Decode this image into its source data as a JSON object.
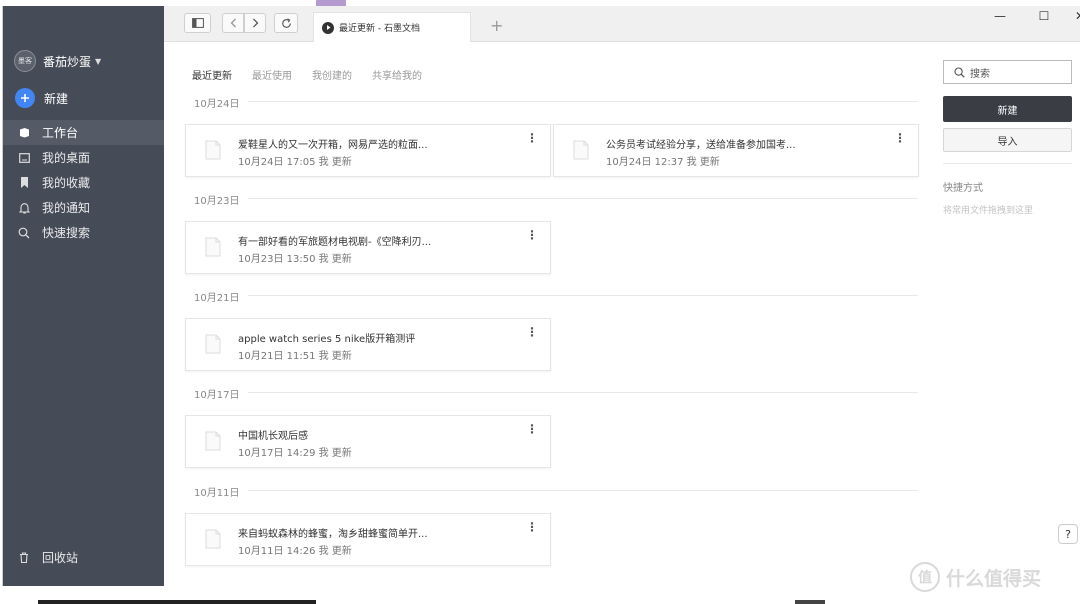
{
  "sidebar": {
    "user": "番茄炒蛋",
    "avatar_text": "墨客",
    "new_label": "新建",
    "items": [
      {
        "label": "工作台",
        "icon": "workbench-icon",
        "active": true
      },
      {
        "label": "我的桌面",
        "icon": "desktop-icon",
        "active": false
      },
      {
        "label": "我的收藏",
        "icon": "bookmark-icon",
        "active": false
      },
      {
        "label": "我的通知",
        "icon": "bell-icon",
        "active": false
      },
      {
        "label": "快速搜索",
        "icon": "search-icon",
        "active": false
      }
    ],
    "trash_label": "回收站"
  },
  "topbar": {
    "tab_title": "最近更新 - 石墨文档",
    "add_tab": "+",
    "window_controls": [
      "—",
      "☐",
      "✕"
    ]
  },
  "subtabs": [
    "最近更新",
    "最近使用",
    "我创建的",
    "共享给我的"
  ],
  "groups": [
    {
      "date": "10月24日",
      "files": [
        {
          "title": "爱鞋星人的又一次开箱，网易严选的粒面...",
          "meta": "10月24日 17:05 我 更新"
        },
        {
          "title": "公务员考试经验分享，送给准备参加国考...",
          "meta": "10月24日 12:37 我 更新"
        }
      ]
    },
    {
      "date": "10月23日",
      "files": [
        {
          "title": "有一部好看的军旅题材电视剧-《空降利刃...",
          "meta": "10月23日 13:50 我 更新"
        }
      ]
    },
    {
      "date": "10月21日",
      "files": [
        {
          "title": "apple watch series 5 nike版开箱测评",
          "meta": "10月21日 11:51 我 更新"
        }
      ]
    },
    {
      "date": "10月17日",
      "files": [
        {
          "title": "中国机长观后感",
          "meta": "10月17日 14:29 我 更新"
        }
      ]
    },
    {
      "date": "10月11日",
      "files": [
        {
          "title": "来自蚂蚁森林的蜂蜜，淘乡甜蜂蜜简单开...",
          "meta": "10月11日 14:26 我 更新"
        }
      ]
    }
  ],
  "right_panel": {
    "search_placeholder": "搜索",
    "new_button": "新建",
    "import_button": "导入",
    "shortcut_title": "快捷方式",
    "shortcut_hint": "将常用文件拖拽到这里"
  },
  "help_label": "?",
  "watermark": {
    "logo": "值",
    "text": "什么值得买"
  },
  "colors": {
    "sidebar_bg": "#464c57",
    "accent_blue": "#4285f4",
    "primary_button": "#3a3e44"
  }
}
